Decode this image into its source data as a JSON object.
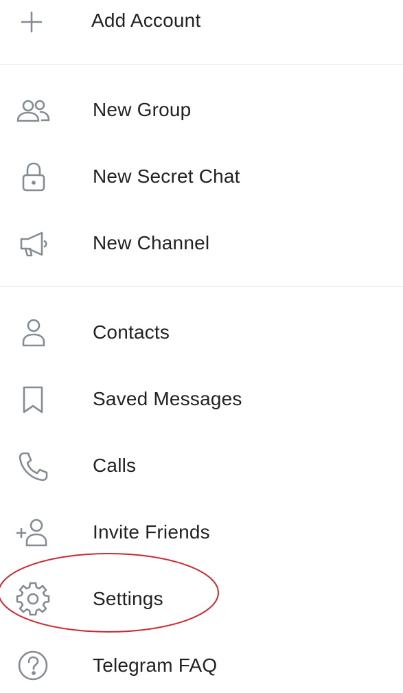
{
  "menu": {
    "add_account": {
      "label": "Add Account",
      "icon": "plus-icon"
    },
    "group_one": [
      {
        "label": "New Group",
        "icon": "people-icon"
      },
      {
        "label": "New Secret Chat",
        "icon": "lock-icon"
      },
      {
        "label": "New Channel",
        "icon": "megaphone-icon"
      }
    ],
    "group_two": [
      {
        "label": "Contacts",
        "icon": "person-icon"
      },
      {
        "label": "Saved Messages",
        "icon": "bookmark-icon"
      },
      {
        "label": "Calls",
        "icon": "phone-icon"
      },
      {
        "label": "Invite Friends",
        "icon": "add-person-icon"
      },
      {
        "label": "Settings",
        "icon": "gear-icon"
      },
      {
        "label": "Telegram FAQ",
        "icon": "question-circle-icon"
      }
    ]
  },
  "colors": {
    "icon": "#838b93",
    "text": "#222222",
    "divider": "#e6e6e6",
    "highlight_annotation": "#cc2a33"
  }
}
